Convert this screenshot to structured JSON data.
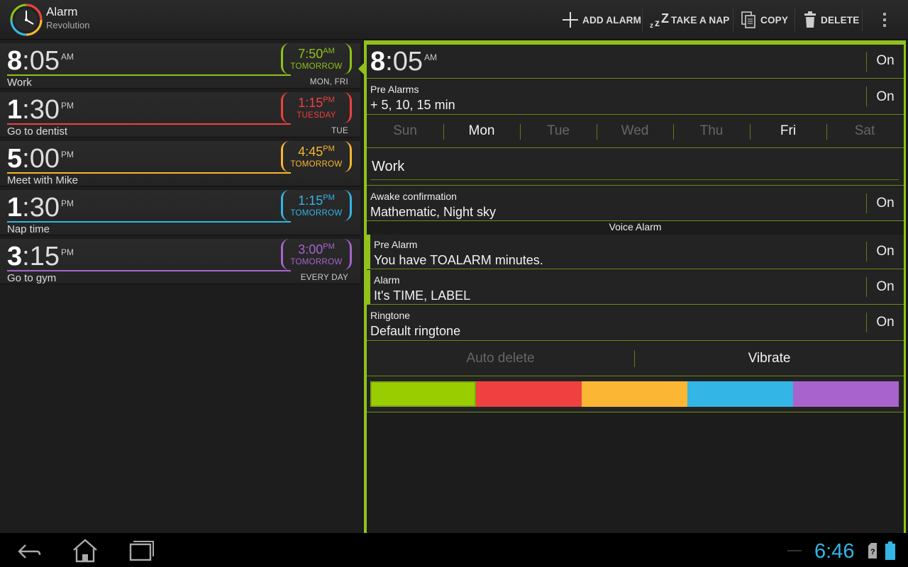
{
  "app": {
    "title": "Alarm",
    "subtitle": "Revolution"
  },
  "actions": {
    "add_alarm": "ADD ALARM",
    "take_nap": "TAKE A NAP",
    "copy": "COPY",
    "delete": "DELETE"
  },
  "colors": {
    "accent": "#8fc21a",
    "red": "#f04040",
    "orange": "#f7b731",
    "blue": "#33b5e5",
    "purple": "#a864cc",
    "clock": "#33b5e5"
  },
  "alarms": [
    {
      "hour": "8",
      "minutes": ":05",
      "ampm": "AM",
      "label": "Work",
      "days": "MON, FRI",
      "ring_time": "7:50",
      "ring_ampm": "AM",
      "ring_when": "TOMORROW",
      "color": "#8fc21a"
    },
    {
      "hour": "1",
      "minutes": ":30",
      "ampm": "PM",
      "label": "Go to dentist",
      "days": "TUE",
      "ring_time": "1:15",
      "ring_ampm": "PM",
      "ring_when": "TUESDAY",
      "color": "#f04040"
    },
    {
      "hour": "5",
      "minutes": ":00",
      "ampm": "PM",
      "label": "Meet with Mike",
      "days": "",
      "ring_time": "4:45",
      "ring_ampm": "PM",
      "ring_when": "TOMORROW",
      "color": "#f7b731"
    },
    {
      "hour": "1",
      "minutes": ":30",
      "ampm": "PM",
      "label": "Nap time",
      "days": "",
      "ring_time": "1:15",
      "ring_ampm": "PM",
      "ring_when": "TOMORROW",
      "color": "#33b5e5"
    },
    {
      "hour": "3",
      "minutes": ":15",
      "ampm": "PM",
      "label": "Go to gym",
      "days": "EVERY DAY",
      "ring_time": "3:00",
      "ring_ampm": "PM",
      "ring_when": "TOMORROW",
      "color": "#a864cc"
    }
  ],
  "detail": {
    "time_hour": "8",
    "time_minutes": ":05",
    "time_ampm": "AM",
    "time_state": "On",
    "pre_alarms_title": "Pre Alarms",
    "pre_alarms_value": "+ 5, 10, 15 min",
    "pre_alarms_state": "On",
    "weekdays": [
      {
        "name": "Sun",
        "active": false
      },
      {
        "name": "Mon",
        "active": true
      },
      {
        "name": "Tue",
        "active": false
      },
      {
        "name": "Wed",
        "active": false
      },
      {
        "name": "Thu",
        "active": false
      },
      {
        "name": "Fri",
        "active": true
      },
      {
        "name": "Sat",
        "active": false
      }
    ],
    "label_value": "Work",
    "awake_title": "Awake confirmation",
    "awake_value": "Mathematic, Night sky",
    "awake_state": "On",
    "voice_header": "Voice Alarm",
    "voice_pre_title": "Pre Alarm",
    "voice_pre_value": "You have TOALARM minutes.",
    "voice_pre_state": "On",
    "voice_alarm_title": "Alarm",
    "voice_alarm_value": "It's TIME, LABEL",
    "voice_alarm_state": "On",
    "ringtone_title": "Ringtone",
    "ringtone_value": "Default ringtone",
    "ringtone_state": "On",
    "auto_delete": "Auto delete",
    "auto_delete_active": false,
    "vibrate": "Vibrate",
    "vibrate_active": true,
    "swatches": [
      "#9acd00",
      "#f04040",
      "#fbb733",
      "#33b5e5",
      "#a864cc"
    ],
    "selected_swatch": 0
  },
  "statusbar": {
    "time": "6:46"
  }
}
